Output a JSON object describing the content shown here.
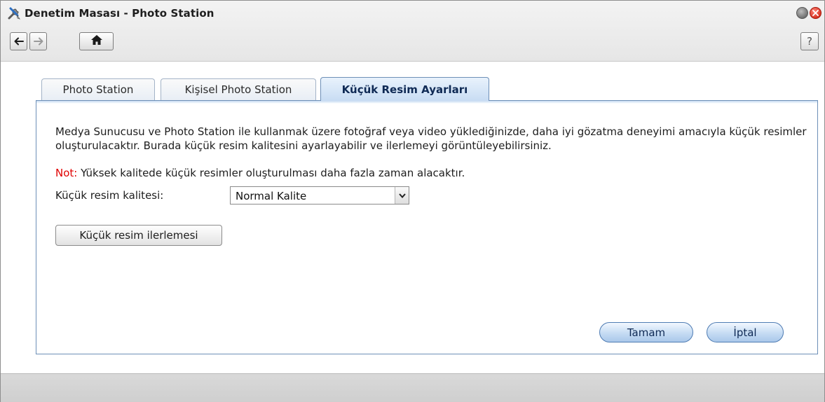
{
  "window": {
    "title": "Denetim Masası - Photo Station",
    "icon": "tools-icon",
    "controls": {
      "minimize_icon": "circle-minimize-icon",
      "close_icon": "circle-close-icon"
    }
  },
  "toolbar": {
    "back_icon": "arrow-left-icon",
    "forward_icon": "arrow-right-icon",
    "home_icon": "home-icon",
    "help_label": "?"
  },
  "tabs": [
    {
      "label": "Photo Station",
      "active": false
    },
    {
      "label": "Kişisel Photo Station",
      "active": false
    },
    {
      "label": "Küçük Resim Ayarları",
      "active": true
    }
  ],
  "content": {
    "description": "Medya Sunucusu ve Photo Station ile kullanmak üzere fotoğraf veya video yüklediğinizde, daha iyi gözatma deneyimi amacıyla küçük resimler oluşturulacaktır. Burada küçük resim kalitesini ayarlayabilir ve ilerlemeyi görüntüleyebilirsiniz.",
    "note_label": "Not:",
    "note_text": " Yüksek kalitede küçük resimler oluşturulması daha fazla zaman alacaktır.",
    "quality_label": "Küçük resim kalitesi:",
    "quality_value": "Normal Kalite",
    "thumbnail_progress_button": "Küçük resim ilerlemesi"
  },
  "actions": {
    "ok_label": "Tamam",
    "cancel_label": "İptal"
  },
  "colors": {
    "accent": "#6d8fb7",
    "note": "#e00000",
    "button_fill": "#c5dbf3"
  }
}
